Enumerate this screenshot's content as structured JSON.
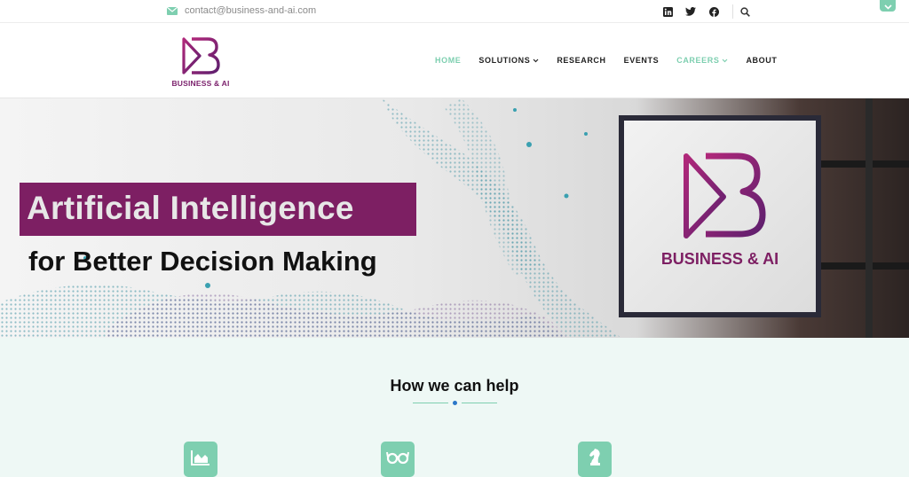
{
  "topbar": {
    "email": "contact@business-and-ai.com",
    "social_icons": [
      "linkedin-icon",
      "twitter-icon",
      "facebook-icon"
    ],
    "search_icon": "search-icon"
  },
  "brand": {
    "name": "BUSINESS & AI",
    "color": "#7d1f63",
    "accent": "#7ecfb0"
  },
  "nav": {
    "items": [
      {
        "label": "HOME",
        "active": true,
        "dropdown": false
      },
      {
        "label": "SOLUTIONS",
        "active": false,
        "dropdown": true
      },
      {
        "label": "RESEARCH",
        "active": false,
        "dropdown": false
      },
      {
        "label": "EVENTS",
        "active": false,
        "dropdown": false
      },
      {
        "label": "CAREERS",
        "active": false,
        "dropdown": true
      },
      {
        "label": "ABOUT",
        "active": false,
        "dropdown": false
      }
    ]
  },
  "hero": {
    "title": "Artificial Intelligence",
    "subtitle": "for Better Decision Making",
    "sign_text": "BUSINESS & AI"
  },
  "help": {
    "title": "How we can help",
    "service_icons": [
      "chart-icon",
      "glasses-icon",
      "chess-knight-icon"
    ]
  }
}
